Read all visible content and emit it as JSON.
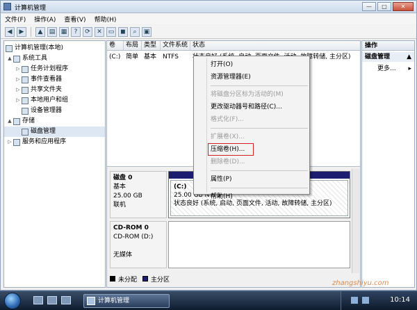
{
  "window": {
    "title": "计算机管理",
    "buttons": {
      "minimize": "—",
      "maximize": "□",
      "close": "✕"
    }
  },
  "menubar": [
    "文件(F)",
    "操作(A)",
    "查看(V)",
    "帮助(H)"
  ],
  "toolbar_icons": [
    "back-icon",
    "forward-icon",
    "up-icon",
    "console-tree-icon",
    "properties-icon",
    "help-icon",
    "refresh-icon",
    "delete-icon",
    "folder-icon",
    "disk-icon",
    "search-icon",
    "console-icon"
  ],
  "tree": {
    "root": "计算机管理(本地)",
    "items": [
      {
        "label": "系统工具",
        "level": 1,
        "expander": "▲"
      },
      {
        "label": "任务计划程序",
        "level": 2,
        "expander": "▷"
      },
      {
        "label": "事件查看器",
        "level": 2,
        "expander": "▷"
      },
      {
        "label": "共享文件夹",
        "level": 2,
        "expander": "▷"
      },
      {
        "label": "本地用户和组",
        "level": 2,
        "expander": "▷"
      },
      {
        "label": "设备管理器",
        "level": 2,
        "expander": ""
      },
      {
        "label": "存储",
        "level": 1,
        "expander": "▲"
      },
      {
        "label": "磁盘管理",
        "level": 2,
        "expander": ""
      },
      {
        "label": "服务和应用程序",
        "level": 1,
        "expander": "▷"
      }
    ]
  },
  "volume_table": {
    "columns": [
      "卷",
      "布局",
      "类型",
      "文件系统",
      "状态"
    ],
    "rows": [
      {
        "volume": "(C:)",
        "layout": "简单",
        "type": "基本",
        "fs": "NTFS",
        "status": "状态良好 (系统, 启动, 页面文件, 活动, 故障转储, 主分区)"
      }
    ]
  },
  "disks": [
    {
      "name": "磁盘 0",
      "type": "基本",
      "size": "25.00 GB",
      "state": "联机",
      "partition": {
        "label": "(C:)",
        "size": "25.00 GB NTFS",
        "status": "状态良好 (系统, 启动, 页面文件, 活动, 故障转储, 主分区)"
      }
    },
    {
      "name": "CD-ROM 0",
      "type": "CD-ROM (D:)",
      "size": "",
      "state": "无媒体"
    }
  ],
  "legend": [
    {
      "label": "未分配",
      "color": "#000000"
    },
    {
      "label": "主分区",
      "color": "#1c1c70"
    }
  ],
  "actions": {
    "title": "操作",
    "section": "磁盘管理",
    "more": "更多..."
  },
  "context_menu": {
    "items": [
      {
        "label": "打开(O)",
        "enabled": true
      },
      {
        "label": "资源管理器(E)",
        "enabled": true
      },
      {
        "sep": true
      },
      {
        "label": "将磁盘分区标为活动的(M)",
        "enabled": false
      },
      {
        "label": "更改驱动器号和路径(C)...",
        "enabled": true
      },
      {
        "label": "格式化(F)...",
        "enabled": false
      },
      {
        "sep": true
      },
      {
        "label": "扩展卷(X)...",
        "enabled": false
      },
      {
        "label": "压缩卷(H)...",
        "enabled": true,
        "highlighted": true
      },
      {
        "label": "删除卷(D)...",
        "enabled": false
      },
      {
        "sep": true
      },
      {
        "label": "属性(P)",
        "enabled": true
      },
      {
        "sep": true
      },
      {
        "label": "帮助(H)",
        "enabled": true
      }
    ]
  },
  "taskbar": {
    "task": "计算机管理",
    "clock": "10:14"
  },
  "watermark": "zhangshiyu.com"
}
